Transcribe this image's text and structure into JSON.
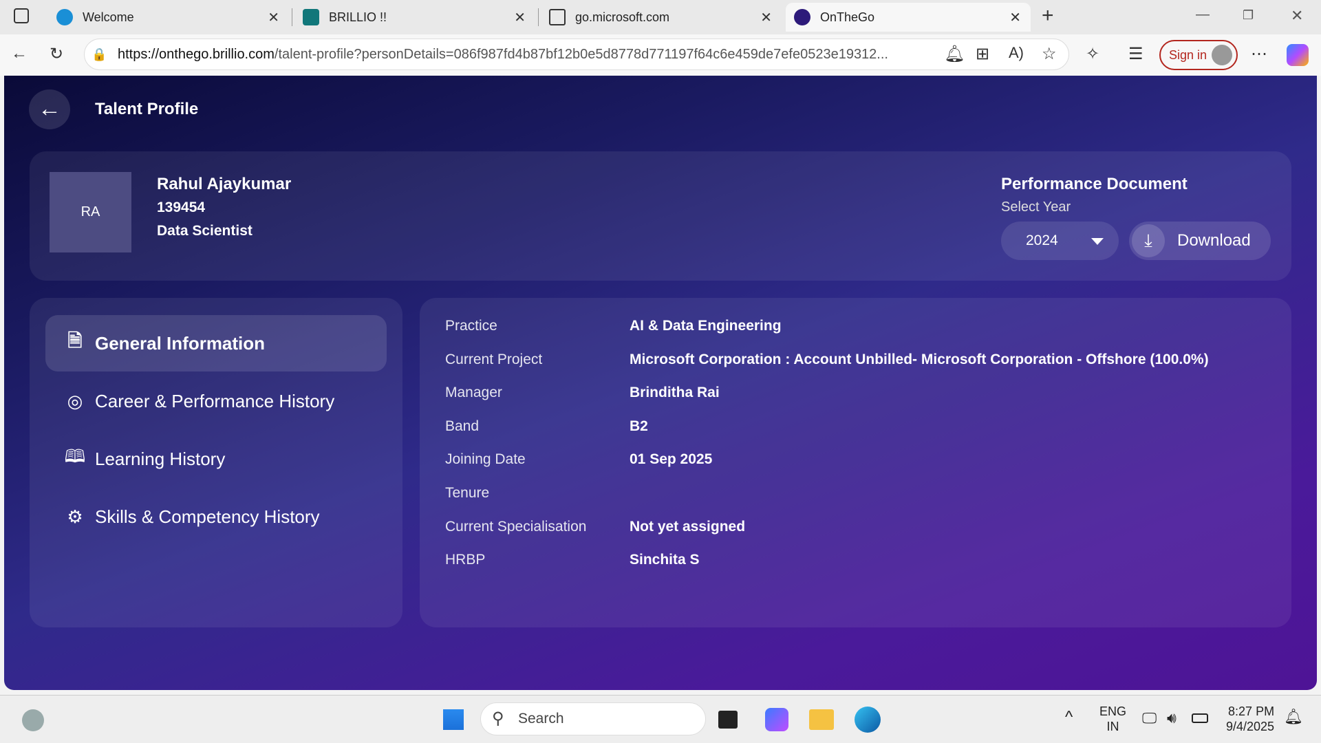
{
  "browser": {
    "tabs": [
      {
        "label": "Welcome"
      },
      {
        "label": "BRILLIO !!"
      },
      {
        "label": "go.microsoft.com"
      },
      {
        "label": "OnTheGo",
        "active": true
      }
    ],
    "url_host": "https://onthego.brillio.com",
    "url_rest": "/talent-profile?personDetails=086f987fd4b87bf12b0e5d8778d771197f64c6e459de7efe0523e19312...",
    "sign_in": "Sign in"
  },
  "header": {
    "title": "Talent Profile"
  },
  "profile": {
    "initials": "RA",
    "name": "Rahul Ajaykumar",
    "id": "139454",
    "role": "Data Scientist"
  },
  "performance": {
    "title": "Performance Document",
    "select_label": "Select Year",
    "year": "2024",
    "download": "Download"
  },
  "nav": [
    {
      "label": "General Information",
      "icon": "document-info-icon",
      "active": true
    },
    {
      "label": "Career & Performance History",
      "icon": "target-icon"
    },
    {
      "label": "Learning History",
      "icon": "book-icon"
    },
    {
      "label": "Skills & Competency History",
      "icon": "head-gear-icon"
    }
  ],
  "info": [
    {
      "label": "Practice",
      "value": "AI & Data Engineering"
    },
    {
      "label": "Current Project",
      "value": "Microsoft Corporation : Account Unbilled- Microsoft Corporation - Offshore (100.0%)"
    },
    {
      "label": "Manager",
      "value": "Brinditha Rai"
    },
    {
      "label": "Band",
      "value": "B2"
    },
    {
      "label": "Joining Date",
      "value": "01 Sep 2025"
    },
    {
      "label": "Tenure",
      "value": ""
    },
    {
      "label": "Current Specialisation",
      "value": "Not yet assigned"
    },
    {
      "label": "HRBP",
      "value": "Sinchita S"
    }
  ],
  "taskbar": {
    "search": "Search",
    "lang1": "ENG",
    "lang2": "IN",
    "time": "8:27 PM",
    "date": "9/4/2025"
  },
  "colors": {
    "accent": "#4e1496",
    "header_bg": "#0a0a38",
    "signin": "#b3261e"
  }
}
